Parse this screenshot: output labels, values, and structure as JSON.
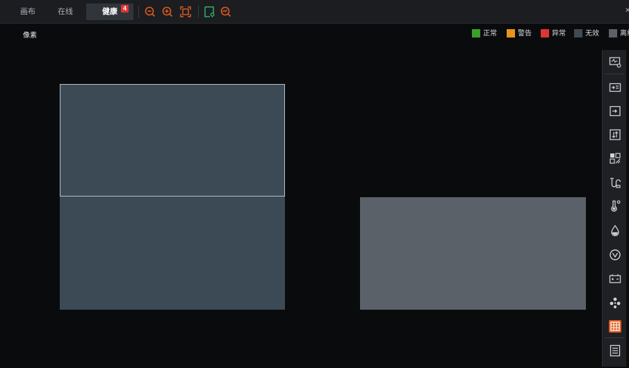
{
  "tabs": [
    {
      "label": "画布"
    },
    {
      "label": "在线"
    },
    {
      "label": "健康",
      "badge": "4"
    }
  ],
  "toolbar": {
    "icons": [
      "zoom-out-icon",
      "zoom-in-icon",
      "fit-screen-icon",
      "add-location-icon",
      "health-check-icon"
    ],
    "accent": "#e05a1e",
    "green": "#2fb06a"
  },
  "view": {
    "mode_label": "像素"
  },
  "legend": [
    {
      "label": "正常",
      "color": "#3aa02a"
    },
    {
      "label": "警告",
      "color": "#e8951b"
    },
    {
      "label": "异常",
      "color": "#e03434"
    },
    {
      "label": "无效",
      "color": "#3f4a55"
    },
    {
      "label": "离线",
      "color": "#5c6068"
    }
  ],
  "blocks": [
    {
      "name": "block-selected",
      "color": "#3b4a55",
      "selected": true
    },
    {
      "name": "block-lower",
      "color": "#3b4a55"
    },
    {
      "name": "block-right",
      "color": "#5b6169"
    }
  ],
  "sidebar": {
    "icons": [
      "monitor-settings-icon",
      "input-card-icon",
      "input-icon",
      "transfer-icon",
      "matrix-icon",
      "cable-icon",
      "temperature-icon",
      "humidity-icon",
      "voltage-icon",
      "battery-icon",
      "fan-icon",
      "grid-icon",
      "list-icon"
    ],
    "active": "grid-icon"
  }
}
